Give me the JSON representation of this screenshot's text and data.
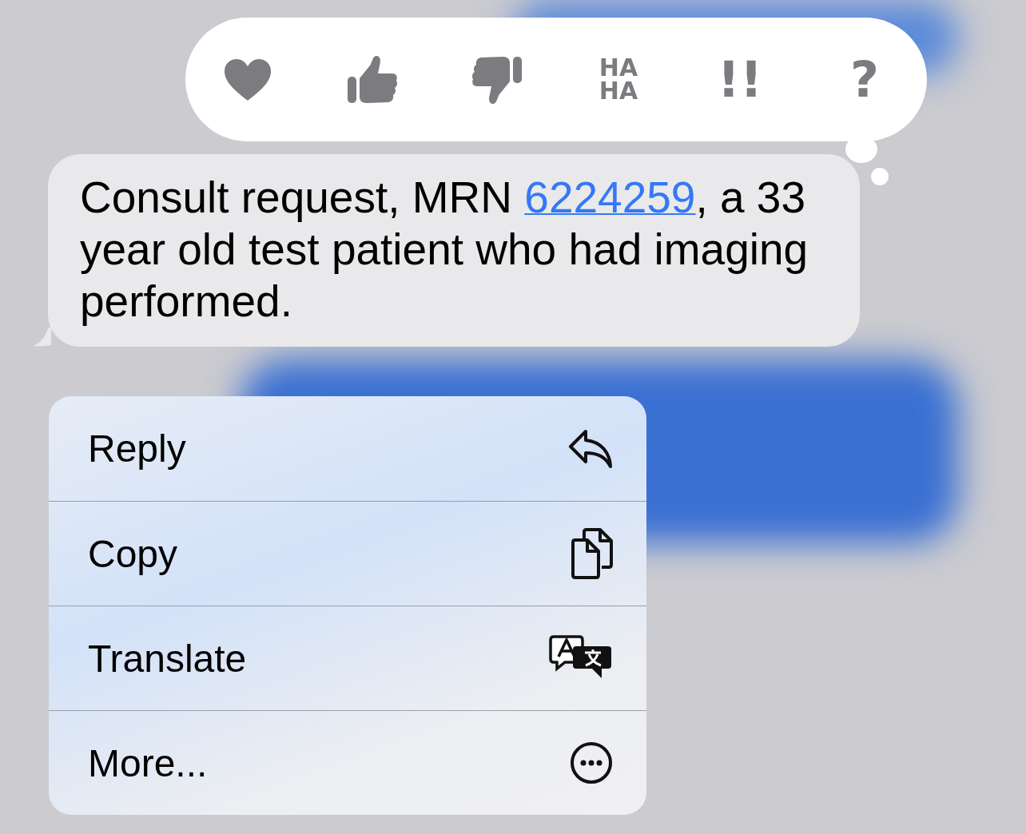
{
  "reactions": [
    {
      "kind": "heart"
    },
    {
      "kind": "thumbs-up"
    },
    {
      "kind": "thumbs-down"
    },
    {
      "kind": "text",
      "label": "HA HA"
    },
    {
      "kind": "text",
      "label": "!!"
    },
    {
      "kind": "text",
      "label": "?"
    }
  ],
  "message": {
    "before": "Consult request, MRN ",
    "link": "6224259",
    "after": ", a 33 year old test patient who had imaging performed."
  },
  "menu": [
    {
      "label": "Reply",
      "kind": "reply"
    },
    {
      "label": "Copy",
      "kind": "copy"
    },
    {
      "label": "Translate",
      "kind": "translate"
    },
    {
      "label": "More...",
      "kind": "more"
    }
  ]
}
